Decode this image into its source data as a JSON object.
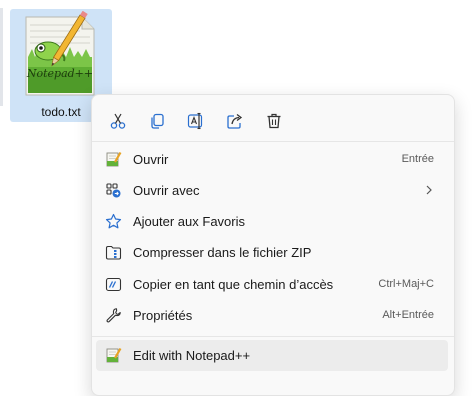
{
  "file": {
    "name": "todo.txt",
    "icon": "notepad-plus-plus-file-icon",
    "logo_text": "Notepad++"
  },
  "toolbar": [
    {
      "name": "cut-icon",
      "tooltip": "Couper"
    },
    {
      "name": "copy-icon",
      "tooltip": "Copier"
    },
    {
      "name": "rename-icon",
      "tooltip": "Renommer"
    },
    {
      "name": "share-icon",
      "tooltip": "Partager"
    },
    {
      "name": "delete-icon",
      "tooltip": "Supprimer"
    }
  ],
  "menu": {
    "items": [
      {
        "label": "Ouvrir",
        "shortcut": "Entrée",
        "icon": "open-notepad-icon"
      },
      {
        "label": "Ouvrir avec",
        "shortcut": "",
        "icon": "open-with-icon",
        "submenu": true
      },
      {
        "label": "Ajouter aux Favoris",
        "shortcut": "",
        "icon": "star-icon"
      },
      {
        "label": "Compresser dans le fichier ZIP",
        "shortcut": "",
        "icon": "zip-icon"
      },
      {
        "label": "Copier en tant que chemin d’accès",
        "shortcut": "Ctrl+Maj+C",
        "icon": "copy-path-icon"
      },
      {
        "label": "Propriétés",
        "shortcut": "Alt+Entrée",
        "icon": "wrench-icon"
      }
    ],
    "extra_item": {
      "label": "Edit with Notepad++",
      "icon": "notepad-plus-plus-icon"
    }
  },
  "colors": {
    "accent": "#2a6fcf",
    "selection": "#cfe3f7",
    "menu_bg": "#f9f9f9",
    "hover": "#ececec"
  }
}
